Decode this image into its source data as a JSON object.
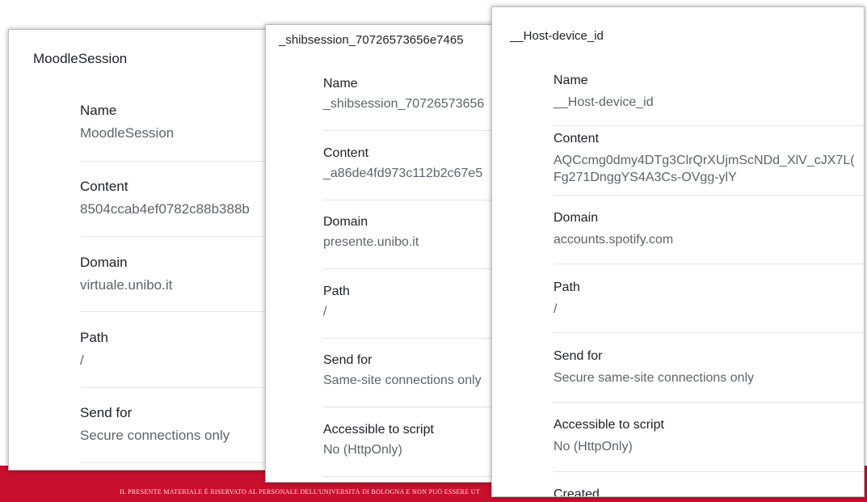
{
  "footer": {
    "text": "IL PRESENTE MATERIALE È RISERVATO AL PERSONALE DELL'UNIVERSITÀ DI BOLOGNA E NON PUÒ ESSERE UT",
    "color": "#c8102e"
  },
  "panels": [
    {
      "title": "MoodleSession",
      "fields": [
        {
          "label": "Name",
          "value": "MoodleSession"
        },
        {
          "label": "Content",
          "value": "8504ccab4ef0782c88b388b"
        },
        {
          "label": "Domain",
          "value": "virtuale.unibo.it"
        },
        {
          "label": "Path",
          "value": "/"
        },
        {
          "label": "Send for",
          "value": "Secure connections only"
        }
      ]
    },
    {
      "title": "_shibsession_70726573656e7465",
      "fields": [
        {
          "label": "Name",
          "value": "_shibsession_70726573656"
        },
        {
          "label": "Content",
          "value": "_a86de4fd973c112b2c67e5"
        },
        {
          "label": "Domain",
          "value": "presente.unibo.it"
        },
        {
          "label": "Path",
          "value": "/"
        },
        {
          "label": "Send for",
          "value": "Same-site connections only"
        },
        {
          "label": "Accessible to script",
          "value": "No (HttpOnly)"
        }
      ]
    },
    {
      "title": "__Host-device_id",
      "fields": [
        {
          "label": "Name",
          "value": "__Host-device_id"
        },
        {
          "label": "Content",
          "value": "AQCcmg0dmy4DTg3ClrQrXUjmScNDd_XlV_cJX7L(",
          "value2": "Fg271DnggYS4A3Cs-OVgg-ylY"
        },
        {
          "label": "Domain",
          "value": "accounts.spotify.com"
        },
        {
          "label": "Path",
          "value": "/"
        },
        {
          "label": "Send for",
          "value": "Secure same-site connections only"
        },
        {
          "label": "Accessible to script",
          "value": "No (HttpOnly)"
        },
        {
          "label": "Created",
          "value": ""
        }
      ]
    }
  ]
}
